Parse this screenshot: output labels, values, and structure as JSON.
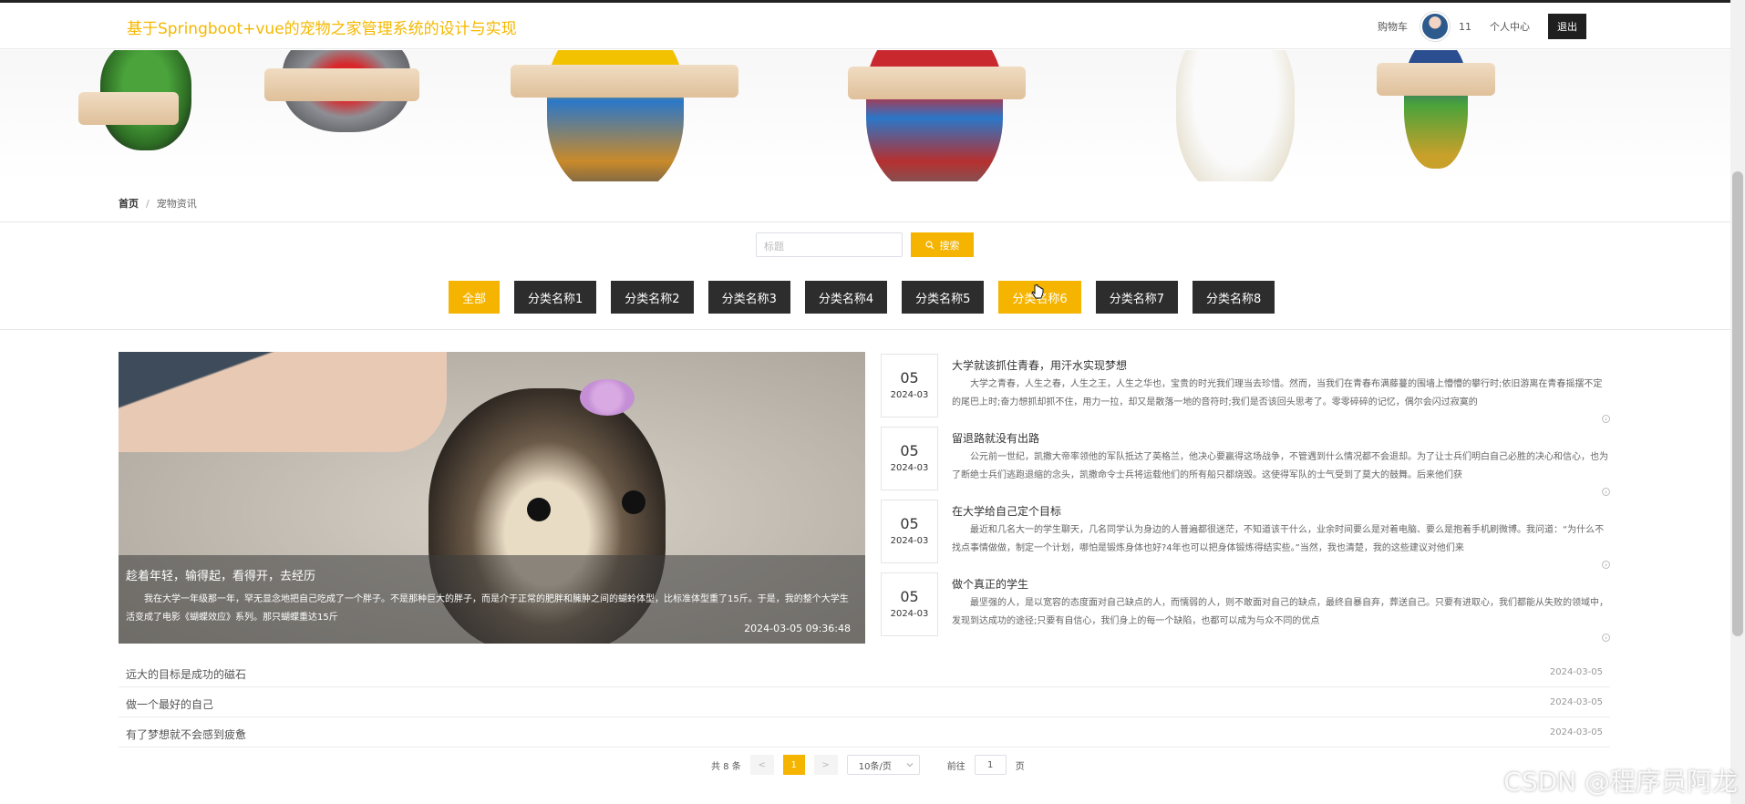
{
  "header": {
    "title": "基于Springboot+vue的宠物之家管理系统的设计与实现",
    "cart": "购物车",
    "user_id": "11",
    "user_center": "个人中心",
    "logout": "退出"
  },
  "breadcrumb": {
    "home": "首页",
    "separator": "/",
    "current": "宠物资讯"
  },
  "search": {
    "placeholder": "标题",
    "button": "搜索",
    "icon": "search-icon"
  },
  "categories": [
    {
      "label": "全部",
      "active": true
    },
    {
      "label": "分类名称1"
    },
    {
      "label": "分类名称2"
    },
    {
      "label": "分类名称3"
    },
    {
      "label": "分类名称4"
    },
    {
      "label": "分类名称5"
    },
    {
      "label": "分类名称6",
      "hover": true
    },
    {
      "label": "分类名称7"
    },
    {
      "label": "分类名称8"
    }
  ],
  "featured": {
    "title": "趁着年轻，输得起，看得开，去经历",
    "desc": "我在大学一年级那一年，罕无显念地把自己吃成了一个胖子。不是那种巨大的胖子，而是介于正常的肥胖和臃肿之间的蝴蛉体型，比标准体型重了15斤。于是，我的整个大学生活变成了电影《蝴蝶效应》系列。那只蝴蝶重达15斤",
    "time": "2024-03-05 09:36:48"
  },
  "news": [
    {
      "day": "05",
      "ym": "2024-03",
      "title": "大学就该抓住青春，用汗水实现梦想",
      "desc": "大学之青春，人生之春，人生之王，人生之华也，宝贵的时光我们理当去珍惜。然而，当我们在青春布满藤蔓的围墙上懵懵的攀行时;依旧游离在青春摇摆不定的尾巴上时;奋力想抓却抓不住，用力一拉，却又是散落一地的音符时;我们是否该回头思考了。零零碎碎的记忆，偶尔会闪过寂寞的"
    },
    {
      "day": "05",
      "ym": "2024-03",
      "title": "留退路就没有出路",
      "desc": "公元前一世纪，凯撒大帝率领他的军队抵达了英格兰，他决心要赢得这场战争，不管遇到什么情况都不会退却。为了让士兵们明白自己必胜的决心和信心，也为了断绝士兵们逃跑退缩的念头，凯撒命令士兵将运载他们的所有船只都烧毁。这使得军队的士气受到了莫大的鼓舞。后来他们获"
    },
    {
      "day": "05",
      "ym": "2024-03",
      "title": "在大学给自己定个目标",
      "desc": "最近和几名大一的学生聊天，几名同学认为身边的人普遍都很迷茫，不知道该干什么，业余时间要么是对着电脑、要么是抱着手机刷微博。我问道：“为什么不找点事情做做，制定一个计划，哪怕是锻炼身体也好?4年也可以把身体锻炼得结实些。”当然，我也清楚，我的这些建议对他们来"
    },
    {
      "day": "05",
      "ym": "2024-03",
      "title": "做个真正的学生",
      "desc": "最坚强的人，是以宽容的态度面对自己缺点的人，而懦弱的人，则不敢面对自己的缺点，最终自暴自弃，葬送自己。只要有进取心，我们都能从失败的领域中，发现到达成功的途径;只要有自信心，我们身上的每一个缺陷，也都可以成为与众不同的优点"
    }
  ],
  "list": [
    {
      "title": "远大的目标是成功的磁石",
      "date": "2024-03-05"
    },
    {
      "title": "做一个最好的自己",
      "date": "2024-03-05"
    },
    {
      "title": "有了梦想就不会感到疲惫",
      "date": "2024-03-05"
    }
  ],
  "pager": {
    "total": "共 8 条",
    "prev": "<",
    "page": "1",
    "next": ">",
    "size": "10条/页",
    "goto_prefix": "前往",
    "goto_value": "1",
    "goto_suffix": "页"
  },
  "watermark": "CSDN @程序员阿龙",
  "colors": {
    "accent": "#f5b400",
    "title": "#f5b800",
    "dark_btn": "#2d2d2d"
  }
}
